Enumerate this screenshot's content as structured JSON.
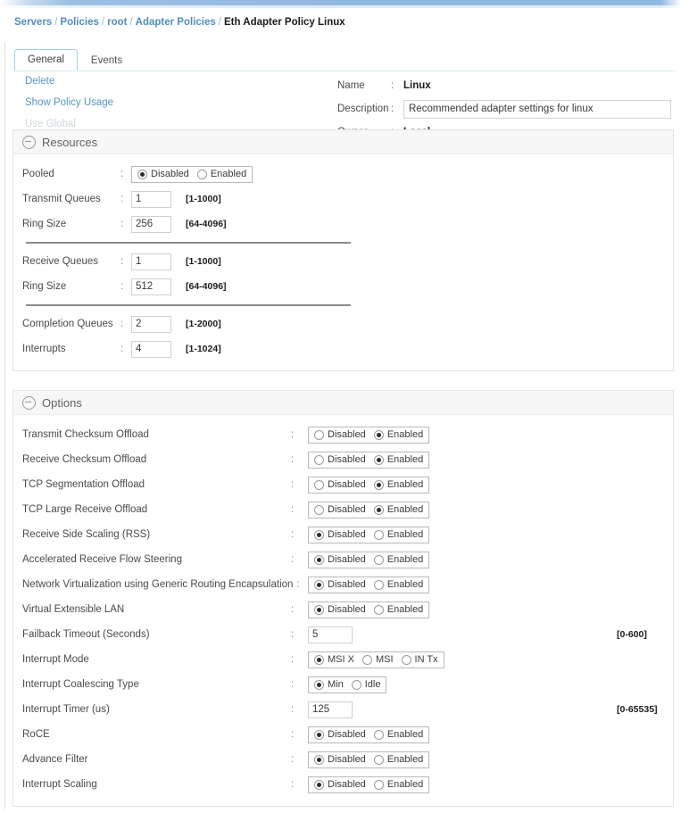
{
  "breadcrumb": {
    "items": [
      "Servers",
      "Policies",
      "root",
      "Adapter Policies"
    ],
    "current": "Eth Adapter Policy Linux",
    "separator": "/"
  },
  "tabs": [
    {
      "label": "General",
      "active": true
    },
    {
      "label": "Events",
      "active": false
    }
  ],
  "actions": [
    {
      "label": "Delete",
      "disabled": false
    },
    {
      "label": "Show Policy Usage",
      "disabled": false
    },
    {
      "label": "Use Global",
      "disabled": true
    }
  ],
  "meta": {
    "colon": ":",
    "name_label": "Name",
    "name_value": "Linux",
    "description_label": "Description",
    "description_value": "Recommended adapter settings for linux",
    "description_placeholder": "",
    "owner_label": "Owner",
    "owner_value": "Local"
  },
  "resources": {
    "title": "Resources",
    "colon": ":",
    "groups": [
      {
        "rows": [
          {
            "label": "Pooled",
            "type": "radio",
            "options": [
              "Disabled",
              "Enabled"
            ],
            "selected": 0,
            "hint": ""
          },
          {
            "label": "Transmit Queues",
            "type": "text",
            "value": "1",
            "hint": "[1-1000]"
          },
          {
            "label": "Ring Size",
            "type": "text",
            "value": "256",
            "hint": "[64-4096]"
          }
        ]
      },
      {
        "rows": [
          {
            "label": "Receive Queues",
            "type": "text",
            "value": "1",
            "hint": "[1-1000]"
          },
          {
            "label": "Ring Size",
            "type": "text",
            "value": "512",
            "hint": "[64-4096]"
          }
        ]
      },
      {
        "rows": [
          {
            "label": "Completion Queues",
            "type": "text",
            "value": "2",
            "hint": "[1-2000]"
          },
          {
            "label": "Interrupts",
            "type": "text",
            "value": "4",
            "hint": "[1-1024]"
          }
        ]
      }
    ]
  },
  "options": {
    "title": "Options",
    "colon": ":",
    "rows": [
      {
        "label": "Transmit Checksum Offload",
        "type": "radio",
        "options": [
          "Disabled",
          "Enabled"
        ],
        "selected": 1,
        "hint": ""
      },
      {
        "label": "Receive Checksum Offload",
        "type": "radio",
        "options": [
          "Disabled",
          "Enabled"
        ],
        "selected": 1,
        "hint": ""
      },
      {
        "label": "TCP Segmentation Offload",
        "type": "radio",
        "options": [
          "Disabled",
          "Enabled"
        ],
        "selected": 1,
        "hint": ""
      },
      {
        "label": "TCP Large Receive Offload",
        "type": "radio",
        "options": [
          "Disabled",
          "Enabled"
        ],
        "selected": 1,
        "hint": ""
      },
      {
        "label": "Receive Side Scaling (RSS)",
        "type": "radio",
        "options": [
          "Disabled",
          "Enabled"
        ],
        "selected": 0,
        "hint": ""
      },
      {
        "label": "Accelerated Receive Flow Steering",
        "type": "radio",
        "options": [
          "Disabled",
          "Enabled"
        ],
        "selected": 0,
        "hint": ""
      },
      {
        "label": "Network Virtualization using Generic Routing Encapsulation",
        "type": "radio",
        "options": [
          "Disabled",
          "Enabled"
        ],
        "selected": 0,
        "hint": ""
      },
      {
        "label": "Virtual Extensible LAN",
        "type": "radio",
        "options": [
          "Disabled",
          "Enabled"
        ],
        "selected": 0,
        "hint": ""
      },
      {
        "label": "Failback Timeout (Seconds)",
        "type": "text",
        "value": "5",
        "hint": "[0-600]"
      },
      {
        "label": "Interrupt Mode",
        "type": "radio",
        "options": [
          "MSI X",
          "MSI",
          "IN Tx"
        ],
        "selected": 0,
        "hint": ""
      },
      {
        "label": "Interrupt Coalescing Type",
        "type": "radio",
        "options": [
          "Min",
          "Idle"
        ],
        "selected": 0,
        "hint": ""
      },
      {
        "label": "Interrupt Timer (us)",
        "type": "text",
        "value": "125",
        "hint": "[0-65535]"
      },
      {
        "label": "RoCE",
        "type": "radio",
        "options": [
          "Disabled",
          "Enabled"
        ],
        "selected": 0,
        "hint": ""
      },
      {
        "label": "Advance Filter",
        "type": "radio",
        "options": [
          "Disabled",
          "Enabled"
        ],
        "selected": 0,
        "hint": ""
      },
      {
        "label": "Interrupt Scaling",
        "type": "radio",
        "options": [
          "Disabled",
          "Enabled"
        ],
        "selected": 0,
        "hint": ""
      }
    ]
  },
  "colors": {
    "link": "#5596c8",
    "breadcrumb_link": "#4f8fc0",
    "tab_accent": "#9fd3e0",
    "topbar": "#8fb8e0"
  }
}
